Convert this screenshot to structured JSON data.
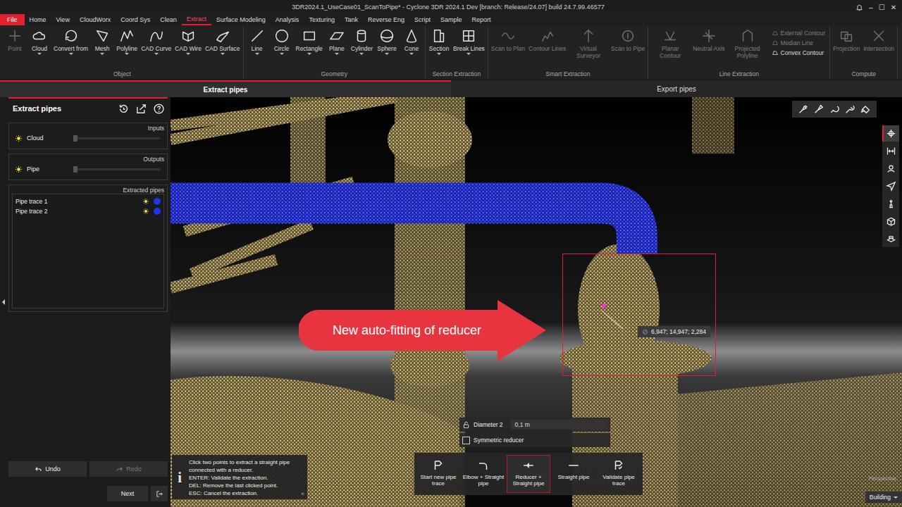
{
  "window": {
    "title": "3DR2024.1_UseCase01_ScanToPipe* - Cyclone 3DR 2024.1 Dev [branch: Release/24.07] build 24.7.99.46577",
    "controls": [
      "–",
      "☐",
      "✕"
    ]
  },
  "menu": [
    {
      "label": "File",
      "kind": "file",
      "selected": false
    },
    {
      "label": "Home",
      "kind": "tab",
      "selected": false
    },
    {
      "label": "View",
      "kind": "tab",
      "selected": false
    },
    {
      "label": "CloudWorx",
      "kind": "tab",
      "selected": false
    },
    {
      "label": "Coord Sys",
      "kind": "tab",
      "selected": false
    },
    {
      "label": "Clean",
      "kind": "tab",
      "selected": false
    },
    {
      "label": "Extract",
      "kind": "tab",
      "selected": true
    },
    {
      "label": "Surface Modeling",
      "kind": "tab",
      "selected": false
    },
    {
      "label": "Analysis",
      "kind": "tab",
      "selected": false
    },
    {
      "label": "Texturing",
      "kind": "tab",
      "selected": false
    },
    {
      "label": "Tank",
      "kind": "tab",
      "selected": false
    },
    {
      "label": "Reverse Eng",
      "kind": "tab",
      "selected": false
    },
    {
      "label": "Script",
      "kind": "tab",
      "selected": false
    },
    {
      "label": "Sample",
      "kind": "tab",
      "selected": false
    },
    {
      "label": "Report",
      "kind": "tab",
      "selected": false
    }
  ],
  "ribbon": {
    "groups": [
      {
        "label": "Object",
        "tools": [
          {
            "label": "Point",
            "disabled": true,
            "dropdown": false
          },
          {
            "label": "Cloud",
            "disabled": false,
            "dropdown": true
          },
          {
            "label": "Convert from",
            "disabled": false,
            "dropdown": true
          },
          {
            "label": "Mesh",
            "disabled": false,
            "dropdown": true
          },
          {
            "label": "Polyline",
            "disabled": false,
            "dropdown": true
          },
          {
            "label": "CAD Curve",
            "disabled": false,
            "dropdown": true
          },
          {
            "label": "CAD Wire",
            "disabled": false,
            "dropdown": true
          },
          {
            "label": "CAD Surface",
            "disabled": false,
            "dropdown": true
          }
        ],
        "small_tools": []
      },
      {
        "label": "Geometry",
        "tools": [
          {
            "label": "Line",
            "disabled": false,
            "dropdown": true
          },
          {
            "label": "Circle",
            "disabled": false,
            "dropdown": true
          },
          {
            "label": "Rectangle",
            "disabled": false,
            "dropdown": true
          },
          {
            "label": "Plane",
            "disabled": false,
            "dropdown": true
          },
          {
            "label": "Cylinder",
            "disabled": false,
            "dropdown": true
          },
          {
            "label": "Sphere",
            "disabled": false,
            "dropdown": true
          },
          {
            "label": "Cone",
            "disabled": false,
            "dropdown": true
          }
        ],
        "small_tools": []
      },
      {
        "label": "Section Extraction",
        "tools": [
          {
            "label": "Section",
            "disabled": false,
            "dropdown": true
          },
          {
            "label": "Break Lines",
            "disabled": false,
            "dropdown": true
          }
        ],
        "small_tools": []
      },
      {
        "label": "Smart Extraction",
        "tools": [
          {
            "label": "Scan to Plan",
            "disabled": true,
            "dropdown": false
          },
          {
            "label": "Contour Lines",
            "disabled": true,
            "dropdown": false
          },
          {
            "label": "Virtual Surveyor",
            "disabled": true,
            "dropdown": false
          },
          {
            "label": "Scan to Pipe",
            "disabled": true,
            "dropdown": false
          }
        ],
        "small_tools": []
      },
      {
        "label": "Line Extraction",
        "tools": [
          {
            "label": "Planar Contour",
            "disabled": true,
            "dropdown": false
          },
          {
            "label": "Neutral Axis",
            "disabled": true,
            "dropdown": false
          },
          {
            "label": "Projected Polyline",
            "disabled": true,
            "dropdown": false
          }
        ],
        "small_tools": [
          {
            "label": "External Contour",
            "disabled": true
          },
          {
            "label": "Median Line",
            "disabled": true
          },
          {
            "label": "Convex Contour",
            "disabled": false
          }
        ]
      },
      {
        "label": "Compute",
        "tools": [
          {
            "label": "Projection",
            "disabled": true,
            "dropdown": false
          },
          {
            "label": "Intersection",
            "disabled": true,
            "dropdown": false
          }
        ],
        "small_tools": []
      }
    ]
  },
  "steps": [
    {
      "label": "Extract pipes",
      "selected": true
    },
    {
      "label": "Export pipes",
      "selected": false
    }
  ],
  "panel": {
    "title": "Extract pipes",
    "inputs": {
      "label": "Inputs",
      "items": [
        {
          "name": "Cloud",
          "visible": true,
          "level": 0
        }
      ]
    },
    "outputs": {
      "label": "Outputs",
      "items": [
        {
          "name": "Pipe",
          "visible": true,
          "level": 0
        }
      ]
    },
    "extracted": {
      "label": "Extracted pipes",
      "items": [
        {
          "name": "Pipe trace 1",
          "visible": true,
          "color": "#1f35e6"
        },
        {
          "name": "Pipe trace 2",
          "visible": true,
          "color": "#1f35e6"
        }
      ]
    },
    "undo": {
      "label": "Undo",
      "disabled": false
    },
    "redo": {
      "label": "Redo",
      "disabled": true
    },
    "next": {
      "label": "Next",
      "disabled": false
    }
  },
  "viewport": {
    "callout": "New auto-fitting of reducer",
    "tooltip": "6,947; 14,947; 2,284",
    "view_mode": "Perspective",
    "layer": "Building",
    "right_tools": [
      {
        "selected": true
      },
      {
        "selected": false
      },
      {
        "selected": false
      },
      {
        "selected": false
      },
      {
        "selected": false
      },
      {
        "selected": false
      },
      {
        "selected": false
      }
    ]
  },
  "reducer_options": {
    "diameter_label": "Diameter 2",
    "diameter_value": "0,1 m",
    "locked": false,
    "symmetric_label": "Symmetric reducer",
    "symmetric": false
  },
  "pipe_tools": [
    {
      "label": "Start new pipe trace",
      "selected": false
    },
    {
      "label": "Elbow + Straight pipe",
      "selected": false
    },
    {
      "label": "Reducer + Straight pipe",
      "selected": true
    },
    {
      "label": "Straight pipe",
      "selected": false
    },
    {
      "label": "Validate pipe trace",
      "selected": false
    }
  ],
  "info": {
    "icon": "i",
    "lines": [
      "Click two points to extract a straight pipe",
      "connected with a reducer.",
      "ENTER: Validate the extraction.",
      "DEL: Remove the last clicked point.",
      "ESC: Cancel the extraction."
    ],
    "collapse": "«"
  }
}
